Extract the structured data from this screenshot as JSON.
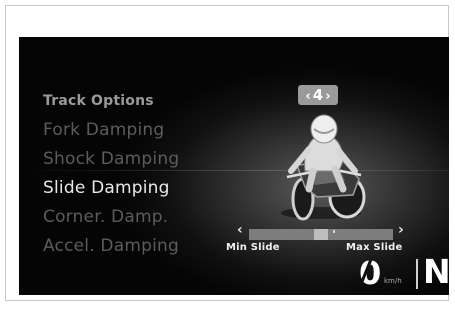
{
  "menu": {
    "header": "Track Options",
    "items": [
      "Fork Damping",
      "Shock Damping",
      "Slide Damping",
      "Corner. Damp.",
      "Accel. Damping"
    ],
    "selected_index": 2
  },
  "setting": {
    "value": "4",
    "left_arrow": "‹",
    "right_arrow": "›"
  },
  "slider": {
    "min_label": "Min Slide",
    "max_label": "Max Slide",
    "left_arrow": "‹",
    "right_arrow": "›",
    "position_fraction": 0.5
  },
  "status": {
    "speed": "0",
    "speed_unit": "km/h",
    "gear": "N"
  },
  "colors": {
    "background": "#000000",
    "active_text": "#e9e9e9",
    "inactive_text": "#5c5c5c"
  },
  "icons": {
    "bike": "motorcycle-rider-icon"
  }
}
